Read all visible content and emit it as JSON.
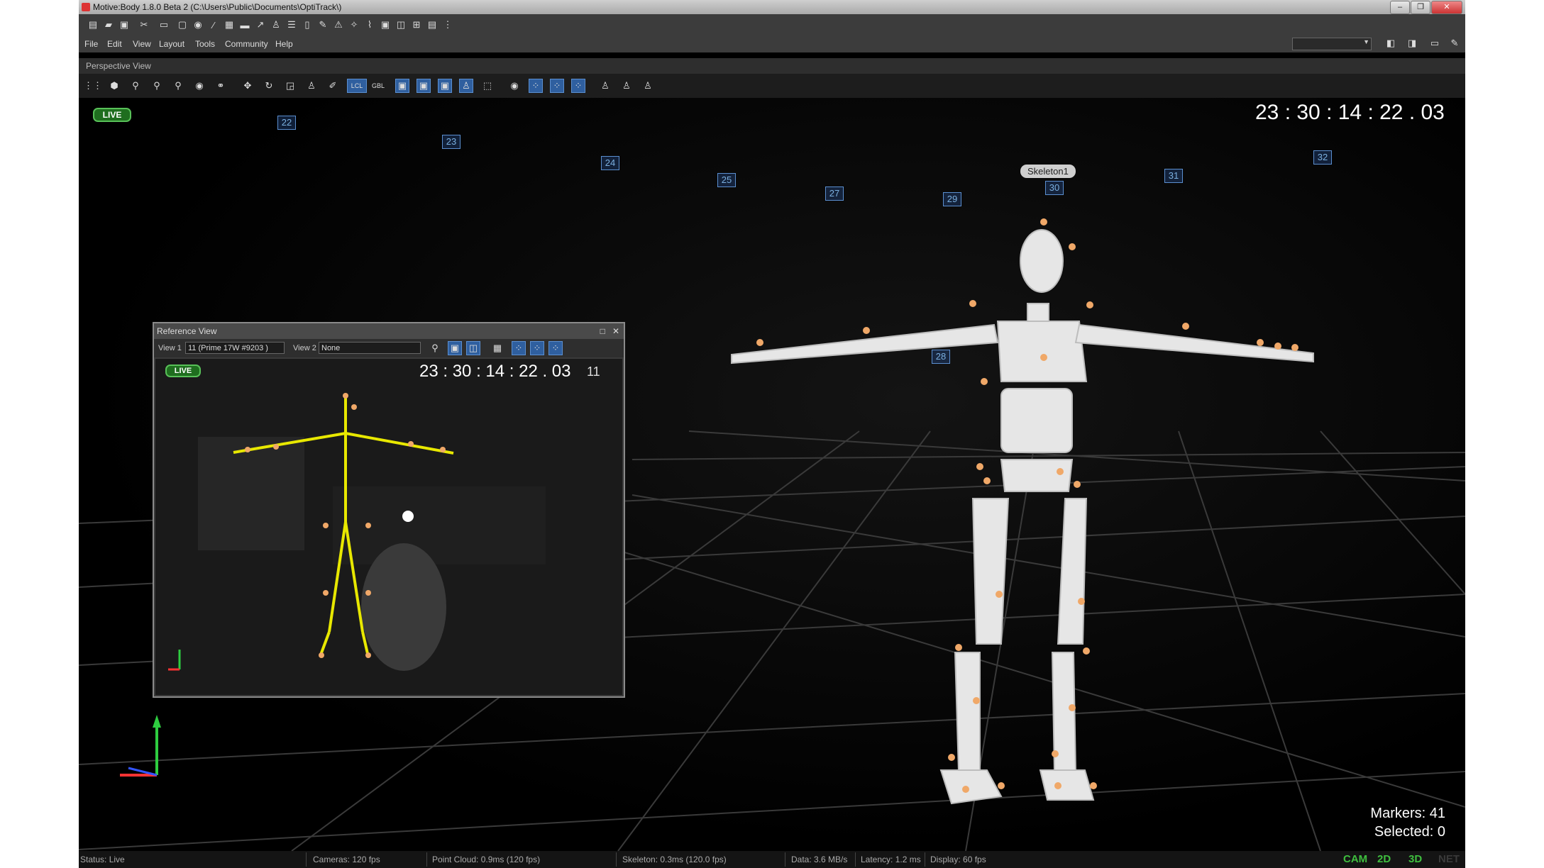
{
  "window": {
    "title": "Motive:Body 1.8.0 Beta 2 (C:\\Users\\Public\\Documents\\OptiTrack\\)"
  },
  "menu": [
    "File",
    "Edit",
    "View",
    "Layout",
    "Tools",
    "Community",
    "Help"
  ],
  "perspective_view": {
    "title": "Perspective View",
    "toolbar": {
      "lcl": "LCL",
      "gbl": "GBL"
    },
    "live": "LIVE",
    "timecode": "23 : 30 : 14 : 22 . 03",
    "skeleton_label": "Skeleton1",
    "camera_ids": [
      "22",
      "23",
      "24",
      "25",
      "27",
      "29",
      "30",
      "31",
      "32",
      "28"
    ],
    "markers_text": "Markers: 41",
    "selected_text": "Selected: 0"
  },
  "reference_view": {
    "title": "Reference View",
    "view1_label": "View 1",
    "view1_value": "11  (Prime 17W #9203 )",
    "view2_label": "View 2",
    "view2_value": "None",
    "live": "LIVE",
    "timecode": "23 : 30 : 14 : 22 . 03",
    "camera_number": "11"
  },
  "status_bar": {
    "status": "Status: Live",
    "cameras": "Cameras: 120 fps",
    "point_cloud": "Point Cloud: 0.9ms (120 fps)",
    "skeleton": "Skeleton: 0.3ms (120.0 fps)",
    "data": "Data: 3.6 MB/s",
    "latency": "Latency: 1.2 ms",
    "display": "Display: 60 fps",
    "modes": [
      "CAM",
      "2D",
      "3D",
      "NET"
    ]
  },
  "colors": {
    "live_green": "#1f6e1f",
    "mode_green": "#3fbf3f",
    "marker_orange": "#f0a868",
    "selection_blue": "#2f5f9f"
  }
}
